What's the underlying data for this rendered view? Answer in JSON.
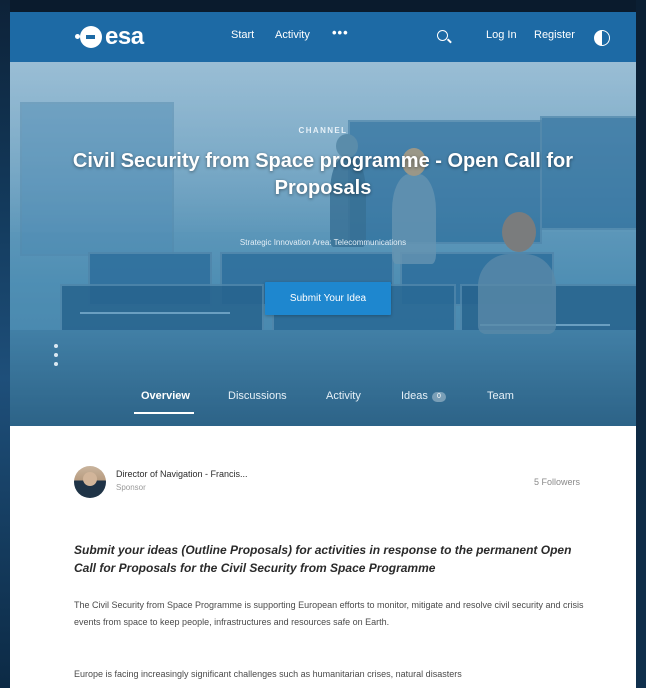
{
  "header": {
    "logo": "esa",
    "nav": [
      "Start",
      "Activity"
    ],
    "more": "•••",
    "login": "Log In",
    "register": "Register"
  },
  "hero": {
    "channel_label": "CHANNEL",
    "title": "Civil Security from Space programme - Open Call for Proposals",
    "subtitle": "Strategic Innovation Area: Telecommunications",
    "cta": "Submit Your Idea",
    "tabs": [
      "Overview",
      "Discussions",
      "Activity",
      "Ideas",
      "Team"
    ],
    "ideas_count": "0"
  },
  "sponsor": {
    "name": "Director of Navigation - Francis...",
    "role": "Sponsor",
    "followers": "5 Followers"
  },
  "body": {
    "summary": "Submit your ideas (Outline Proposals) for activities in response to the permanent Open Call for Proposals for the Civil Security from Space Programme",
    "paragraph1": "The Civil Security from Space Programme is supporting European efforts to monitor, mitigate and resolve civil security and crisis events from space to keep people, infrastructures and resources safe on Earth.",
    "paragraph2": "Europe is facing increasingly significant challenges such as humanitarian crises, natural disasters"
  },
  "colors": {
    "header": "#1d6aa5",
    "cta": "#1e87cf"
  }
}
